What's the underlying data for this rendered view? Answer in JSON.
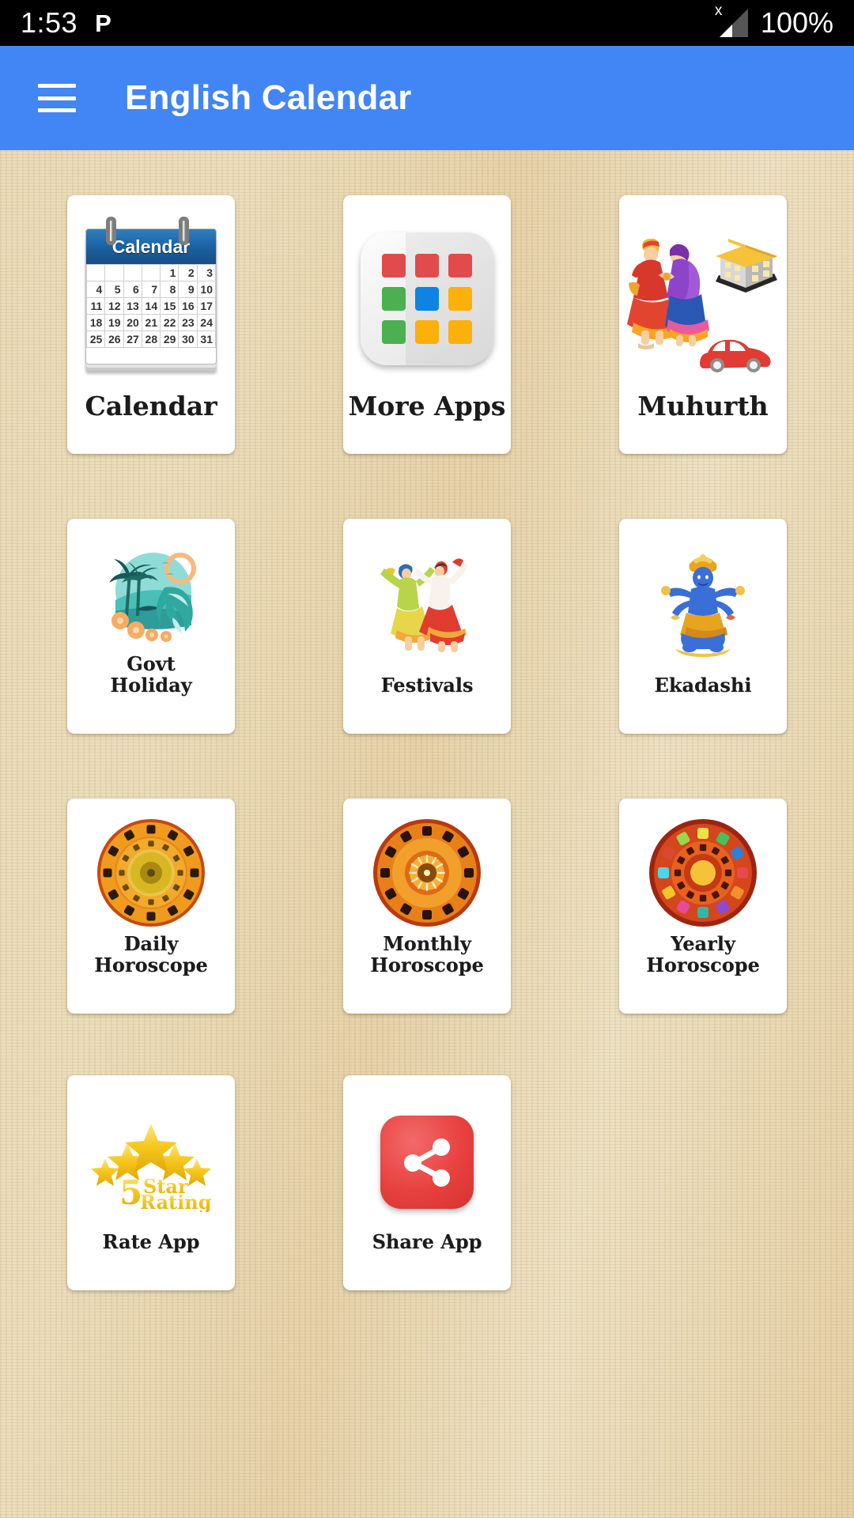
{
  "status_bar": {
    "time": "1:53",
    "app_badge": "P",
    "signal_icon": "no-sim-signal-icon",
    "signal_badge": "x",
    "battery_percent": "100%"
  },
  "app_bar": {
    "menu_icon": "hamburger-menu-icon",
    "title": "English Calendar",
    "background_color": "#4285f4",
    "title_color": "#ffffff"
  },
  "theme": {
    "background_color": "#e6d2a6",
    "card_color": "#ffffff",
    "label_color": "#1b1b1b"
  },
  "grid": {
    "columns": 3,
    "items": [
      {
        "id": "calendar",
        "label": "Calendar",
        "icon": "desk-calendar-icon",
        "row": 1
      },
      {
        "id": "more-apps",
        "label": "More Apps",
        "icon": "apps-grid-icon",
        "row": 1
      },
      {
        "id": "muhurth",
        "label": "Muhurth",
        "icon": "wedding-house-car-icon",
        "row": 1
      },
      {
        "id": "govt-holiday",
        "label": "Govt\nHoliday",
        "icon": "beach-vacation-icon",
        "row": 2
      },
      {
        "id": "festivals",
        "label": "Festivals",
        "icon": "folk-dancers-icon",
        "row": 2
      },
      {
        "id": "ekadashi",
        "label": "Ekadashi",
        "icon": "vishnu-deity-icon",
        "row": 2
      },
      {
        "id": "daily-horoscope",
        "label": "Daily\nHoroscope",
        "icon": "zodiac-wheel-icon",
        "row": 3
      },
      {
        "id": "monthly-horoscope",
        "label": "Monthly\nHoroscope",
        "icon": "zodiac-wheel-icon",
        "row": 3
      },
      {
        "id": "yearly-horoscope",
        "label": "Yearly\nHoroscope",
        "icon": "zodiac-wheel-icon",
        "row": 3
      },
      {
        "id": "rate-app",
        "label": "Rate App",
        "icon": "five-star-rating-icon",
        "row": 4
      },
      {
        "id": "share-app",
        "label": "Share App",
        "icon": "share-nodes-icon",
        "row": 4
      }
    ]
  },
  "calendar_icon": {
    "header": "Calendar",
    "weeks": [
      [
        "",
        "",
        "",
        "",
        "1",
        "2",
        "3"
      ],
      [
        "4",
        "5",
        "6",
        "7",
        "8",
        "9",
        "10"
      ],
      [
        "11",
        "12",
        "13",
        "14",
        "15",
        "16",
        "17"
      ],
      [
        "18",
        "19",
        "20",
        "21",
        "22",
        "23",
        "24"
      ],
      [
        "25",
        "26",
        "27",
        "28",
        "29",
        "30",
        "31"
      ]
    ],
    "header_color": "#1b5f9e"
  },
  "more_apps_icon": {
    "tile_colors": [
      "#e14b4b",
      "#e14b4b",
      "#e14b4b",
      "#4caf50",
      "#0d84e3",
      "#fcb00a",
      "#4caf50",
      "#fcb00a",
      "#fcb00a"
    ]
  },
  "rate_app_icon": {
    "digit": "5",
    "line1": "Star",
    "line2": "Rating",
    "star_color": "#f5c518"
  },
  "share_app_icon": {
    "background_color": "#e8413f",
    "glyph_color": "#ffffff"
  }
}
